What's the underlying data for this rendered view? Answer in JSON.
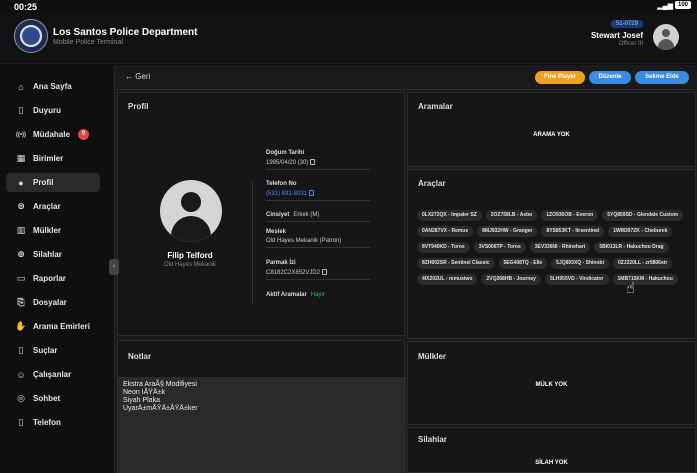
{
  "status": {
    "time": "00:25",
    "battery": "100"
  },
  "header": {
    "department": "Los Santos Police Department",
    "subtitle": "Mobile Police Terminal",
    "callsign": "51-0729",
    "user_name": "Stewart Josef",
    "user_rank": "Officer III"
  },
  "sidebar": {
    "items": [
      {
        "label": "Ana Sayfa",
        "icon": "home-icon",
        "glyph": "⌂"
      },
      {
        "label": "Duyuru",
        "icon": "bookmark-icon",
        "glyph": "▯"
      },
      {
        "label": "Müdahale",
        "icon": "radio-icon",
        "glyph": "((•))",
        "badge": "9"
      },
      {
        "label": "Birimler",
        "icon": "grid-icon",
        "glyph": "▦"
      },
      {
        "label": "Profil",
        "icon": "user-icon",
        "glyph": "●",
        "active": true
      },
      {
        "label": "Araçlar",
        "icon": "car-icon",
        "glyph": "⊜"
      },
      {
        "label": "Mülkler",
        "icon": "building-icon",
        "glyph": "▥"
      },
      {
        "label": "Silahlar",
        "icon": "crosshair-icon",
        "glyph": "⊕"
      },
      {
        "label": "Raporlar",
        "icon": "folder-icon",
        "glyph": "▭"
      },
      {
        "label": "Dosyalar",
        "icon": "file-icon",
        "glyph": "⎘"
      },
      {
        "label": "Arama Emirleri",
        "icon": "hand-icon",
        "glyph": "✋"
      },
      {
        "label": "Suçlar",
        "icon": "book-icon",
        "glyph": "▯"
      },
      {
        "label": "Çalışanlar",
        "icon": "users-icon",
        "glyph": "☺"
      },
      {
        "label": "Sohbet",
        "icon": "chat-icon",
        "glyph": "◎"
      },
      {
        "label": "Telefon",
        "icon": "phone-icon",
        "glyph": "▯"
      }
    ]
  },
  "toolbar": {
    "back_label": "Geri",
    "fine_label": "Fine Player",
    "edit_label": "Düzenle",
    "custody_label": "Sekme Elde"
  },
  "profile": {
    "title": "Profil",
    "name": "Filip Telford",
    "occupation_sub": "Old Hayes Mekanik",
    "dob_label": "Doğum Tarihi",
    "dob_value": "1995/04/20 (30)",
    "phone_label": "Telefon No",
    "phone_value": "(531) 891-8031",
    "gender_label": "Cinsiyet",
    "gender_value": "Erkek (M)",
    "job_label": "Meslek",
    "job_value": "Old Hayes Mekanik (Patron)",
    "fingerprint_label": "Parmak İzi",
    "fingerprint_value": "C8182C2X852VJD2",
    "wanted_label": "Aktif Aramalar",
    "wanted_value": "Hayır"
  },
  "searches": {
    "title": "Aramalar",
    "empty": "ARAMA YOK"
  },
  "vehicles": {
    "title": "Araçlar",
    "plates": [
      "0LX272QX - Impaler SZ",
      "2OZ758LB - Asbo",
      "1ZO936OB - Everon",
      "5YQ859SD - Glendale Custom",
      "0AN287VX - Remus",
      "8MJ932HW - Granger",
      "8YS853KT - Itrsentinel",
      "1WM397ZK - Cheburek",
      "8VT940KD - Toros",
      "3VS006TP - Toros",
      "3EV336NI - Rhinehart",
      "5BI013LR - Hakuchou Drag",
      "8ZH002SR - Sentinel Classic",
      "5EG408TQ - Elle",
      "5JQ893XQ - Shinobi",
      "0ZJ220LL - zr5806str",
      "4IX202UL - remustwo",
      "2VQ268HB - Journey",
      "5LH955VD - Vindicator",
      "1MB715KM - Hakuchou"
    ]
  },
  "notes": {
    "title": "Notlar",
    "lines": [
      "Ekstra AraÃ§ Modifiyesi",
      "Neon IÅŸÄ±k",
      "Siyah Plaka",
      "UyarÄ±mÅŸÄ±ÅŸÄ±ker"
    ]
  },
  "properties": {
    "title": "Mülkler",
    "empty": "MÜLK YOK"
  },
  "weapons": {
    "title": "Silahlar",
    "empty": "SİLAH YOK"
  }
}
